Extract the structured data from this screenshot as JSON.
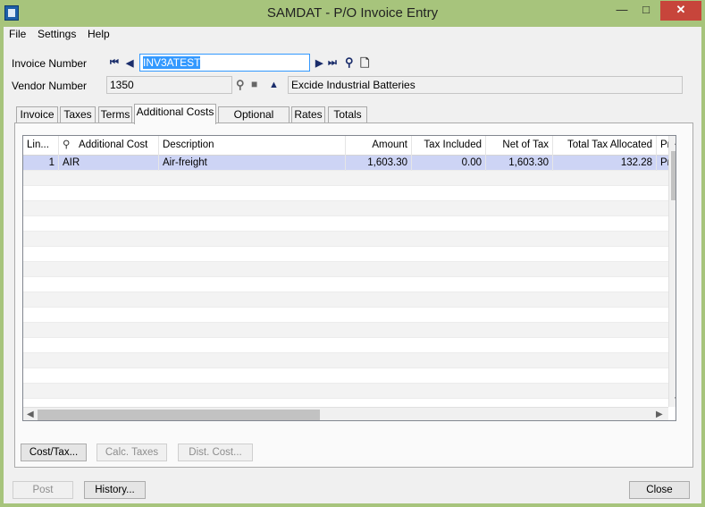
{
  "window": {
    "title": "SAMDAT - P/O Invoice Entry"
  },
  "menu": [
    "File",
    "Settings",
    "Help"
  ],
  "header": {
    "invoice_number_label": "Invoice Number",
    "invoice_number_value": "INV3ATEST",
    "vendor_number_label": "Vendor Number",
    "vendor_number_value": "1350",
    "vendor_name": "Excide Industrial Batteries"
  },
  "tabs": [
    "Invoice",
    "Taxes",
    "Terms",
    "Additional Costs",
    "Optional Fields",
    "Rates",
    "Totals"
  ],
  "active_tab": "Additional Costs",
  "grid": {
    "columns": [
      "Lin...",
      "Additional Cost",
      "Description",
      "Amount",
      "Tax Included",
      "Net of Tax",
      "Total Tax Allocated",
      "Pr"
    ],
    "rows": [
      [
        "1",
        "AIR",
        "Air-freight",
        "1,603.30",
        "0.00",
        "1,603.30",
        "132.28",
        "Pr"
      ]
    ]
  },
  "panel_buttons": {
    "cost_tax": "Cost/Tax...",
    "calc_taxes": "Calc. Taxes",
    "dist_cost": "Dist. Cost..."
  },
  "footer_buttons": {
    "post": "Post",
    "history": "History...",
    "close": "Close"
  },
  "colors": {
    "title_bar": "#a7c47c",
    "selected_row": "#cdd4f5",
    "selection_highlight": "#3399ff"
  }
}
